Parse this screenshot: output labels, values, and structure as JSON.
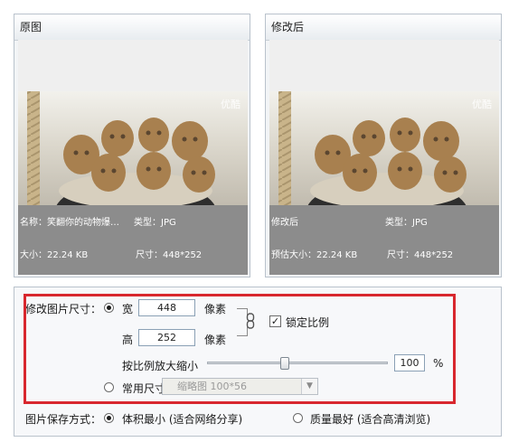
{
  "original_panel": {
    "title": "原图",
    "watermark": "优酷",
    "name_text": "名称：笑翻你的动物爆…",
    "type_text": "类型：JPG",
    "size_text": "大小：22.24 KB",
    "dimension_text": "尺寸：448*252"
  },
  "modified_panel": {
    "title": "修改后",
    "watermark": "优酷",
    "name_text": "修改后",
    "type_text": "类型：JPG",
    "size_text": "预估大小：22.24 KB",
    "dimension_text": "尺寸：448*252"
  },
  "resize": {
    "section_label": "修改图片尺寸：",
    "width_label": "宽",
    "width_value": "448",
    "width_unit": "像素",
    "height_label": "高",
    "height_value": "252",
    "height_unit": "像素",
    "lock_ratio_label": "锁定比例",
    "lock_ratio_checked": true,
    "scale_label": "按比例放大缩小",
    "scale_value": "100",
    "scale_unit": "%",
    "scale_level": 0.5,
    "common_size_label": "常用尺寸",
    "common_size_selected": "缩略图 100*56"
  },
  "save_mode": {
    "label": "图片保存方式：",
    "option_small": "体积最小 (适合网络分享)",
    "option_quality": "质量最好 (适合高清浏览)"
  },
  "colors": {
    "highlight_border": "#d8272e",
    "info_band": "#8c8c8c"
  }
}
